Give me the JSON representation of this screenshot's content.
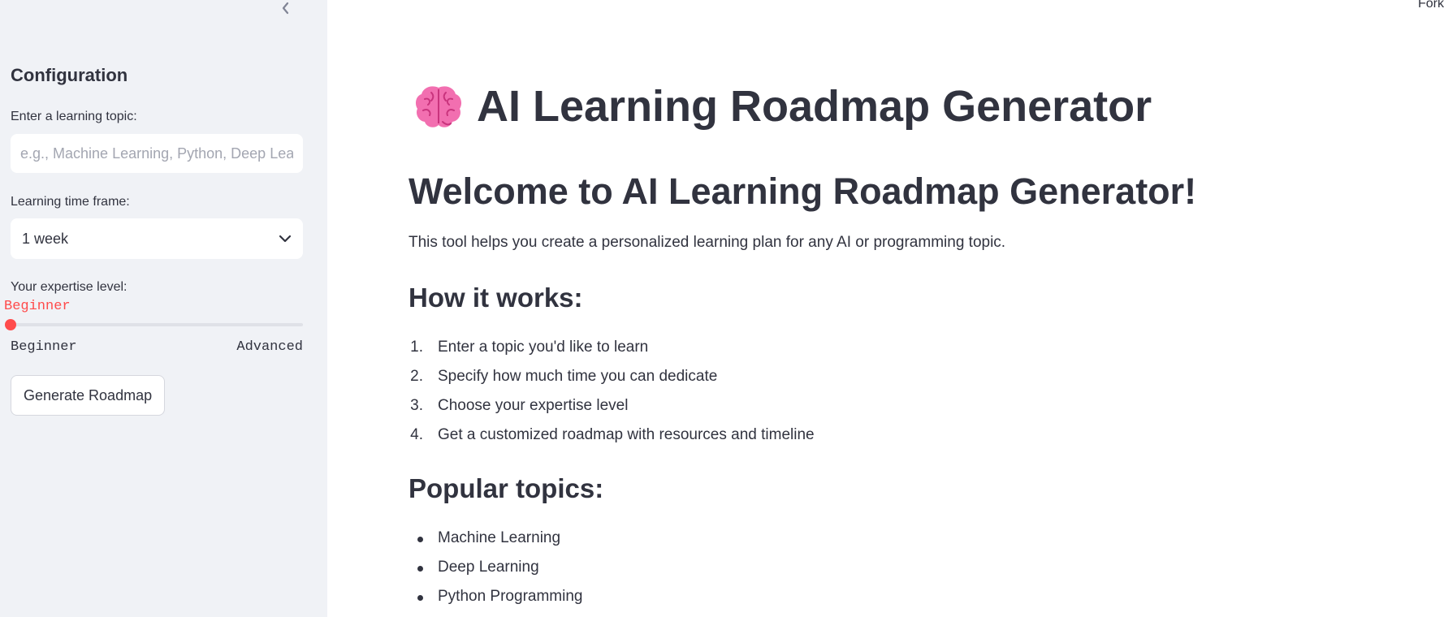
{
  "top": {
    "fork_label": "Fork"
  },
  "sidebar": {
    "title": "Configuration",
    "topic_label": "Enter a learning topic:",
    "topic_placeholder": "e.g., Machine Learning, Python, Deep Learning",
    "topic_value": "",
    "timeframe_label": "Learning time frame:",
    "timeframe_selected": "1 week",
    "expertise_label": "Your expertise level:",
    "expertise_value": "Beginner",
    "expertise_level_fraction": 0,
    "expertise_min": "Beginner",
    "expertise_max": "Advanced",
    "generate_button": "Generate Roadmap",
    "accent_color": "#ff4b4b"
  },
  "main": {
    "title_icon": "brain-icon",
    "title": "AI Learning Roadmap Generator",
    "welcome": "Welcome to AI Learning Roadmap Generator!",
    "intro": "This tool helps you create a personalized learning plan for any AI or programming topic.",
    "how_heading": "How it works:",
    "steps": [
      {
        "num": "1.",
        "text": "Enter a topic you'd like to learn"
      },
      {
        "num": "2.",
        "text": "Specify how much time you can dedicate"
      },
      {
        "num": "3.",
        "text": "Choose your expertise level"
      },
      {
        "num": "4.",
        "text": "Get a customized roadmap with resources and timeline"
      }
    ],
    "popular_heading": "Popular topics:",
    "topics": [
      "Machine Learning",
      "Deep Learning",
      "Python Programming"
    ]
  }
}
